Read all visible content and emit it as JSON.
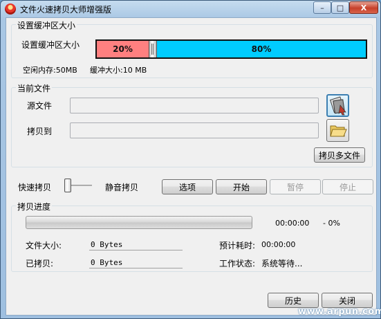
{
  "window": {
    "title": "文件火速拷贝大师增强版",
    "min_label": "–",
    "max_label": "□",
    "close_label": "X"
  },
  "buffer": {
    "group_title": "设置缓冲区大小",
    "label": "设置缓冲区大小",
    "slider_fraction": 0.2,
    "left_percent_label": "20%",
    "right_percent_label": "80%",
    "left_color": "#ff8080",
    "right_color": "#00ccff",
    "free_memory_label": "空闲内存:50MB",
    "buffer_size_label": "缓冲大小:10 MB"
  },
  "files": {
    "group_title": "当前文件",
    "source_label": "源文件",
    "source_value": "",
    "dest_label": "拷贝到",
    "dest_value": "",
    "source_icon": "file-picker-icon",
    "dest_icon": "folder-icon",
    "multi_button": "拷贝多文件"
  },
  "controls": {
    "fast_copy_label": "快速拷贝",
    "silent_copy_label": "静音拷贝",
    "mode_slider_fraction": 0,
    "options_button": "选项",
    "start_button": "开始",
    "pause_button": "暂停",
    "stop_button": "停止"
  },
  "progress": {
    "group_title": "拷贝进度",
    "fraction": 0,
    "elapsed_time": "00:00:00",
    "percent_text": "- 0%",
    "file_size_label": "文件大小:",
    "file_size_value": "0 Bytes",
    "copied_label": "已拷贝:",
    "copied_value": "0 Bytes",
    "estimated_label": "预计耗时:",
    "estimated_value": "00:00:00",
    "status_label": "工作状态:",
    "status_value": "系统等待..."
  },
  "footer": {
    "history_button": "历史",
    "close_button": "关闭",
    "watermark": "www.arpun.com"
  }
}
